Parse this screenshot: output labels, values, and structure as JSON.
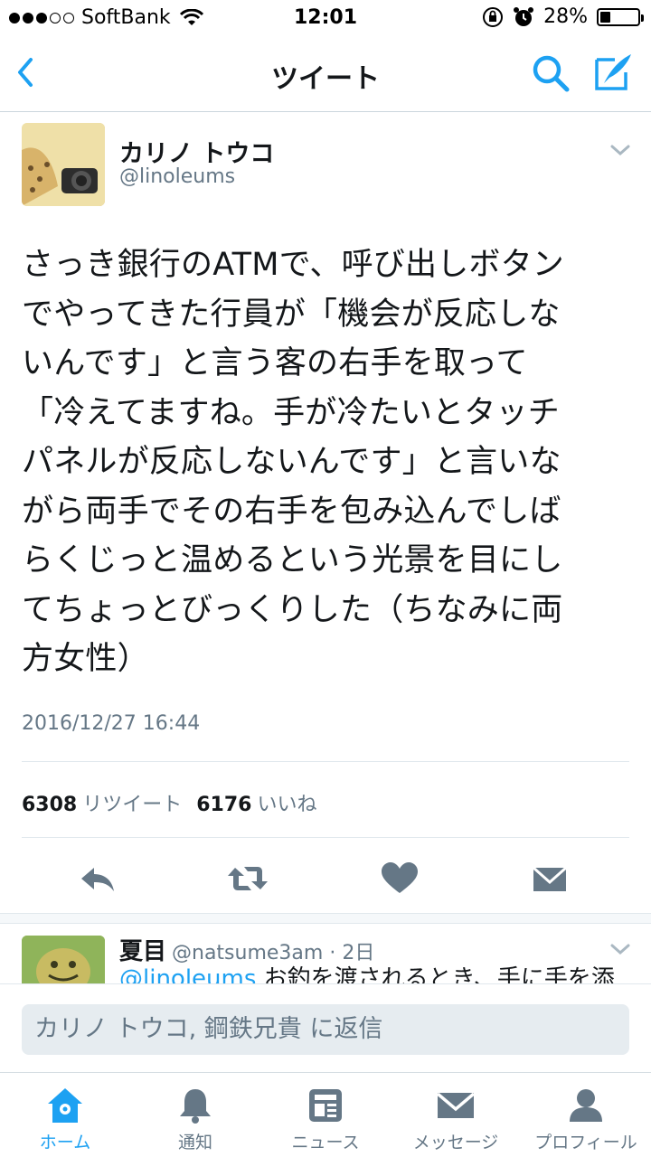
{
  "status_bar": {
    "carrier": "SoftBank",
    "time": "12:01",
    "battery": "28%",
    "battery_level": 0.28,
    "signal_bars": 3
  },
  "header": {
    "title": "ツイート",
    "back_icon": "chevron-left-icon",
    "search_icon": "search-icon",
    "compose_icon": "compose-icon"
  },
  "tweet": {
    "user_name": "カリノ トウコ",
    "handle": "@linoleums",
    "text": "さっき銀行のATMで、呼び出しボタン\nでやってきた行員が「機会が反応しな\nいんです」と言う客の右手を取って\n「冷えてますね。手が冷たいとタッチ\nパネルが反応しないんです」と言いな\nがら両手でその右手を包み込んでしば\nらくじっと温めるという光景を目にし\nてちょっとびっくりした（ちなみに両\n方女性）",
    "timestamp": "2016/12/27 16:44",
    "retweet_count": "6308",
    "retweet_label": "リツイート",
    "like_count": "6176",
    "like_label": "いいね"
  },
  "reply": {
    "user_name": "夏目",
    "handle": "@natsume3am",
    "age": "2日",
    "mention": "@linoleums",
    "text": " お釣を渡されるとき、手に手を添"
  },
  "reply_box": {
    "placeholder": "カリノ トウコ, 鋼鉄兄貴 に返信"
  },
  "tabs": [
    {
      "label": "ホーム",
      "icon": "home-icon",
      "active": true
    },
    {
      "label": "通知",
      "icon": "bell-icon",
      "active": false
    },
    {
      "label": "ニュース",
      "icon": "news-icon",
      "active": false
    },
    {
      "label": "メッセージ",
      "icon": "envelope-icon",
      "active": false
    },
    {
      "label": "プロフィール",
      "icon": "profile-icon",
      "active": false
    }
  ],
  "colors": {
    "accent": "#1da1f2",
    "muted": "#657786",
    "icon_gray": "#657786"
  }
}
